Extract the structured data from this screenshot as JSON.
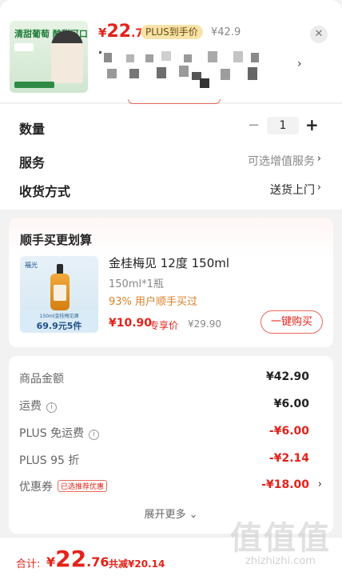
{
  "header": {
    "thumbnail_text": "清甜葡萄 酸甜可口",
    "price_symbol": "¥",
    "price_int": "22",
    "price_dec": ".76",
    "plus_tag": "PLUS到手价",
    "original_price": "¥42.9",
    "close_icon": "close-icon",
    "spec_chevron": "›"
  },
  "options": {
    "quantity_label": "数量",
    "quantity_minus": "−",
    "quantity_value": "1",
    "quantity_plus": "+",
    "service_label": "服务",
    "service_value": "可选增值服务",
    "delivery_label": "收货方式",
    "delivery_value": "送货上门",
    "chevron": "›"
  },
  "cross_sell": {
    "title": "顺手买更划算",
    "image_logo": "福光",
    "image_deal_sub": "150ml金桂梅见酒",
    "image_deal_main": "69.9元5件",
    "product_name": "金桂梅见 12度 150ml",
    "product_spec": "150ml*1瓶",
    "popularity": "93% 用户顺手买过",
    "price": "¥10.90",
    "price_tag": "专享价",
    "original_price": "¥29.90",
    "buy_button": "一键购买"
  },
  "breakdown": {
    "rows": [
      {
        "label": "商品金额",
        "value": "¥42.90",
        "tone": "black"
      },
      {
        "label": "运费",
        "value": "¥6.00",
        "tone": "black",
        "info": "i"
      },
      {
        "label": "PLUS 免运费",
        "value": "-¥6.00",
        "tone": "red",
        "info": "i"
      },
      {
        "label": "PLUS 95 折",
        "value": "-¥2.14",
        "tone": "red"
      },
      {
        "label": "优惠券",
        "value": "-¥18.00",
        "tone": "red",
        "tag": "已选推荐优惠"
      }
    ],
    "expand_label": "展开更多 ⌄"
  },
  "footer": {
    "total_label": "合计:",
    "price_symbol": "¥",
    "price_int": "22",
    "price_dec": ".76",
    "savings": "共减¥20.14"
  },
  "watermark": {
    "big": "值值值",
    "url": "zhizhizhi.com"
  },
  "colors": {
    "accent_red": "#e2231a",
    "plus_gold": "#f7e3a8",
    "background": "#f2f2f2"
  }
}
